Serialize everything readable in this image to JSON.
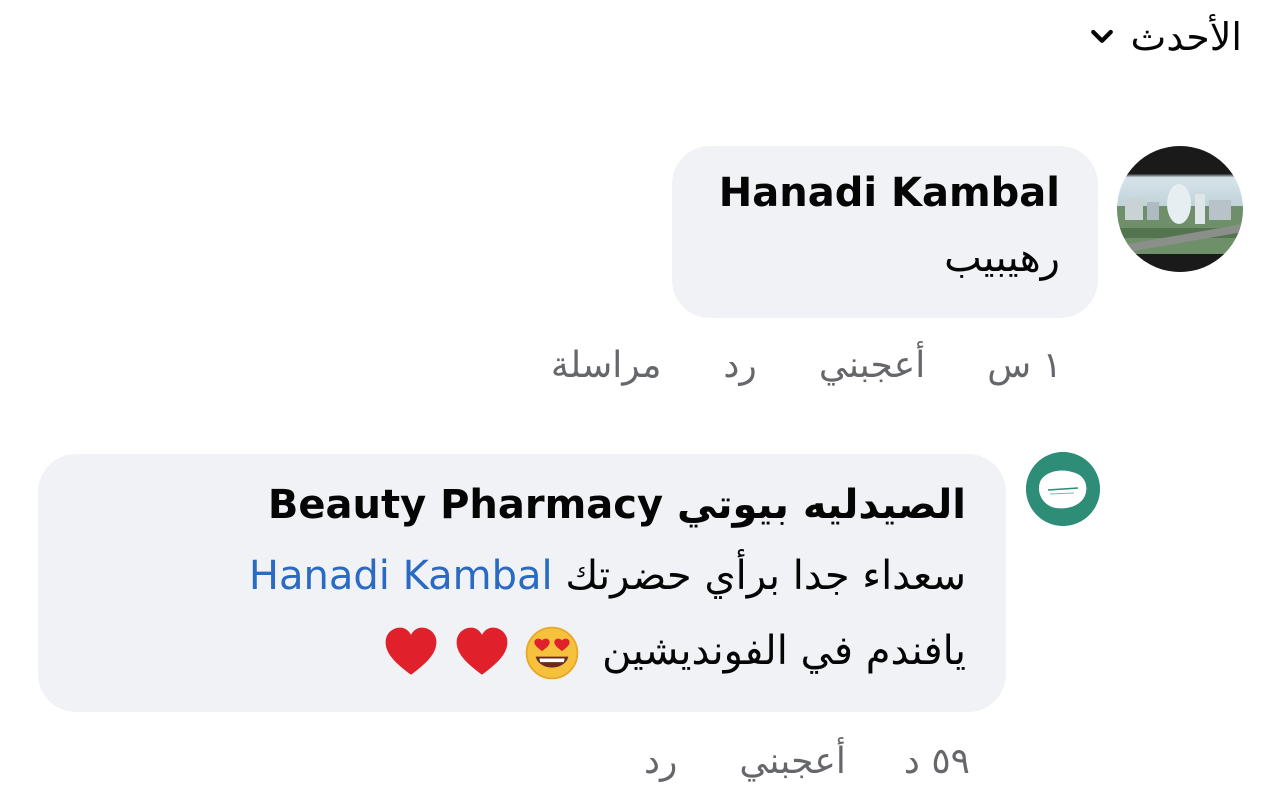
{
  "sort": {
    "label": "الأحدث",
    "icon": "chevron-down-icon"
  },
  "comments": [
    {
      "author": "Hanadi Kambal",
      "text": "رهيبيب",
      "actions": {
        "time": "١ س",
        "like": "أعجبني",
        "reply": "رد",
        "message": "مراسلة"
      }
    },
    {
      "author": "الصيدليه بيوتي Beauty Pharmacy",
      "line1_text": "سعداء جدا برأي حضرتك",
      "mention": "Hanadi Kambal",
      "line2_text": "يافندم في الفونديشين",
      "emojis": [
        "heart-eyes-emoji",
        "red-heart-emoji",
        "red-heart-emoji"
      ],
      "actions": {
        "time": "٥٩ د",
        "like": "أعجبني",
        "reply": "رد"
      }
    }
  ],
  "colors": {
    "bubble": "#f0f2f5",
    "mention": "#2a6ac2",
    "meta": "#65676b",
    "text": "#050505"
  }
}
